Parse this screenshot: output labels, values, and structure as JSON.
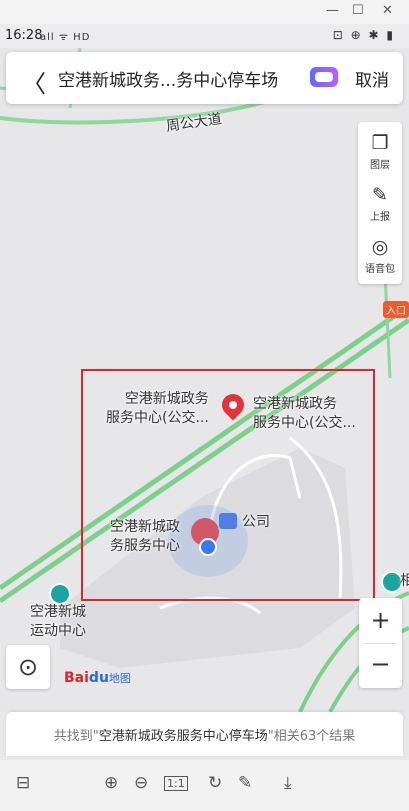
{
  "window": {
    "minimize_glyph": "—",
    "maximize_glyph": "☐",
    "close_glyph": "✕"
  },
  "status_bar": {
    "time": "16:28",
    "signal_text": "all ᯤ HD",
    "right_icons": "⊡ ⊕ ✱ ▮"
  },
  "search_bar": {
    "back_glyph": "〈",
    "query": "空港新城政务...务中心停车场",
    "cancel": "取消",
    "assistant_icon": "robot-icon"
  },
  "map": {
    "road_label": "周公大道",
    "places": [
      {
        "line1": "空港新城政务",
        "line2": "服务中心(公交..."
      },
      {
        "line1": "空港新城政务",
        "line2": "服务中心(公交..."
      },
      {
        "line1": "空港新城政",
        "line2": "务服务中心"
      },
      {
        "line1": "公司"
      },
      {
        "line1": "空港新城",
        "line2": "运动中心"
      }
    ],
    "partial_label": "相",
    "entrance": "入口",
    "highlight_color": "#d6282d",
    "road_color": "#7dd08a"
  },
  "tools": [
    {
      "icon": "layers-icon",
      "glyph": "❐",
      "label": "图层"
    },
    {
      "icon": "report-icon",
      "glyph": "✎",
      "label": "上报"
    },
    {
      "icon": "voice-pack-icon",
      "glyph": "◎",
      "label": "语音包"
    }
  ],
  "zoom": {
    "in": "+",
    "out": "−"
  },
  "locate_glyph": "⊙",
  "logo": {
    "text": "Bai",
    "paw": "du",
    "sub": "地图"
  },
  "result": {
    "prefix": "共找到\"",
    "keyword": "空港新城政务服务中心停车场",
    "suffix": "\"相关63个结果"
  },
  "bottom_toolbar": [
    {
      "icon": "panel-icon",
      "glyph": "⊟"
    },
    {
      "icon": "zoom-in-icon",
      "glyph": "⊕"
    },
    {
      "icon": "zoom-out-icon",
      "glyph": "⊖"
    },
    {
      "icon": "actual-size-icon",
      "glyph": "1:1"
    },
    {
      "icon": "rotate-icon",
      "glyph": "↻"
    },
    {
      "icon": "edit-icon",
      "glyph": "✎"
    },
    {
      "icon": "download-icon",
      "glyph": "⤓"
    }
  ]
}
